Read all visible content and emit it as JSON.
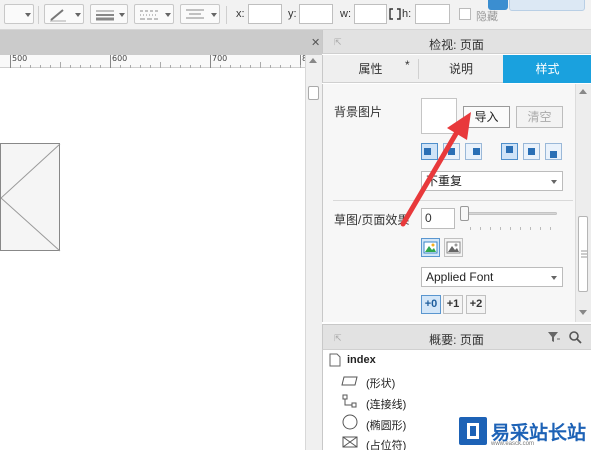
{
  "toolbar": {
    "x_label": "x:",
    "y_label": "y:",
    "w_label": "w:",
    "h_label": "h:",
    "hide_label": "隐藏",
    "top_button_label": "..."
  },
  "canvas": {
    "ruler_labels": [
      "500",
      "600",
      "700",
      "800"
    ]
  },
  "inspector": {
    "title": "检视: 页面",
    "tabs": [
      {
        "label": "属性",
        "modified": "*"
      },
      {
        "label": "说明"
      },
      {
        "label": "样式"
      }
    ],
    "background_image_label": "背景图片",
    "import_button": "导入",
    "clear_button": "清空",
    "repeat_select": "不重复",
    "sketch_effect_label": "草图/页面效果",
    "sketch_value": "0",
    "font_select": "Applied Font",
    "stepper_buttons": [
      "+0",
      "+1",
      "+2"
    ]
  },
  "outline": {
    "title": "概要: 页面",
    "items": [
      {
        "label": "index",
        "icon": "page-icon"
      },
      {
        "label": "(形状)",
        "icon": "shape-icon"
      },
      {
        "label": "(连接线)",
        "icon": "connector-icon"
      },
      {
        "label": "(椭圆形)",
        "icon": "ellipse-icon"
      },
      {
        "label": "(占位符)",
        "icon": "placeholder-icon"
      }
    ]
  },
  "watermark": {
    "text": "易采站长站",
    "sub": "www.easck.com"
  },
  "colors": {
    "accent": "#1aa1de",
    "arrow": "#e8393b",
    "watermark": "#1d62b6"
  }
}
